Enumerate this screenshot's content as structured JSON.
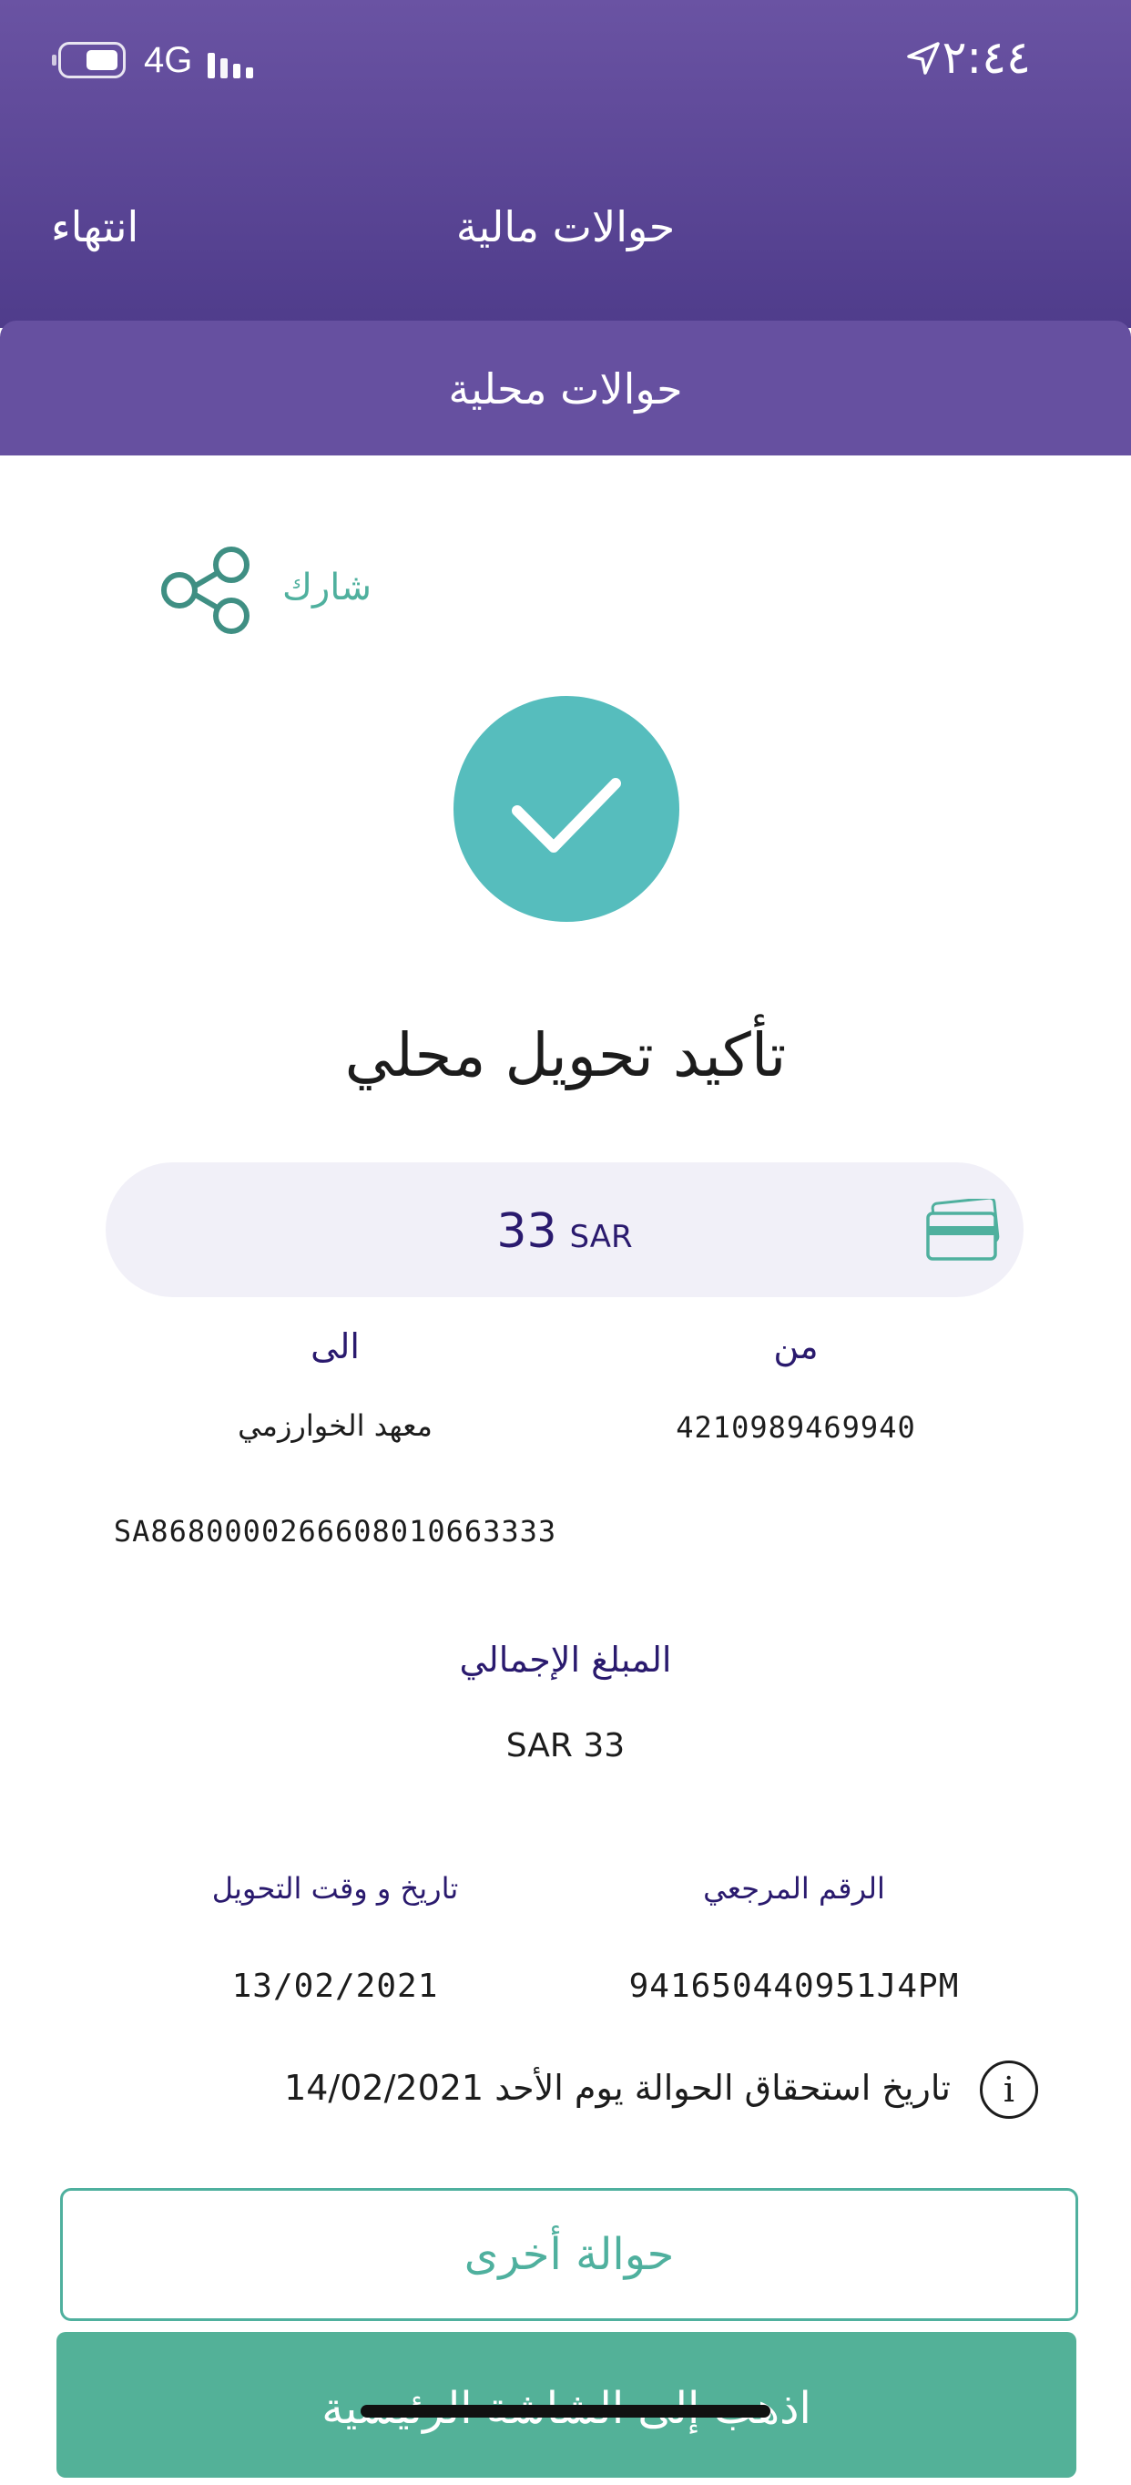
{
  "status_bar": {
    "network": "4G",
    "time": "٢:٤٤"
  },
  "nav": {
    "title": "حوالات مالية",
    "done_label": "انتهاء"
  },
  "segment": {
    "label": "حوالات محلية"
  },
  "share": {
    "label": "شارك"
  },
  "confirmation": {
    "title": "تأكيد تحويل محلي",
    "amount_value": "33",
    "amount_currency": "SAR"
  },
  "transfer": {
    "from_label": "من",
    "to_label": "الى",
    "from_account": "4210989469940",
    "to_name": "معهد الخوارزمي",
    "to_iban": "SA8680000266608010663333",
    "total_label": "المبلغ الإجمالي",
    "total_value": "SAR 33",
    "reference_label": "الرقم المرجعي",
    "datetime_label": "تاريخ و وقت التحويل",
    "reference_value": "941650440951J4PM",
    "datetime_value": "13/02/2021"
  },
  "info": {
    "icon_text": "i",
    "due_text": "تاريخ استحقاق الحوالة يوم الأحد 14/02/2021"
  },
  "buttons": {
    "another_transfer": "حوالة أخرى",
    "go_home": "اذهب إلى الشاشة الرئيسية"
  },
  "colors": {
    "header": "#5a4497",
    "accent": "#4fb09e",
    "success": "#56bdbd",
    "purple_text": "#2a1a6e"
  },
  "icons": {
    "battery": "battery-icon",
    "signal": "signal-bars-icon",
    "location": "location-arrow-icon",
    "share": "share-icon",
    "success": "checkmark-icon",
    "card": "credit-card-icon",
    "info": "info-icon"
  }
}
